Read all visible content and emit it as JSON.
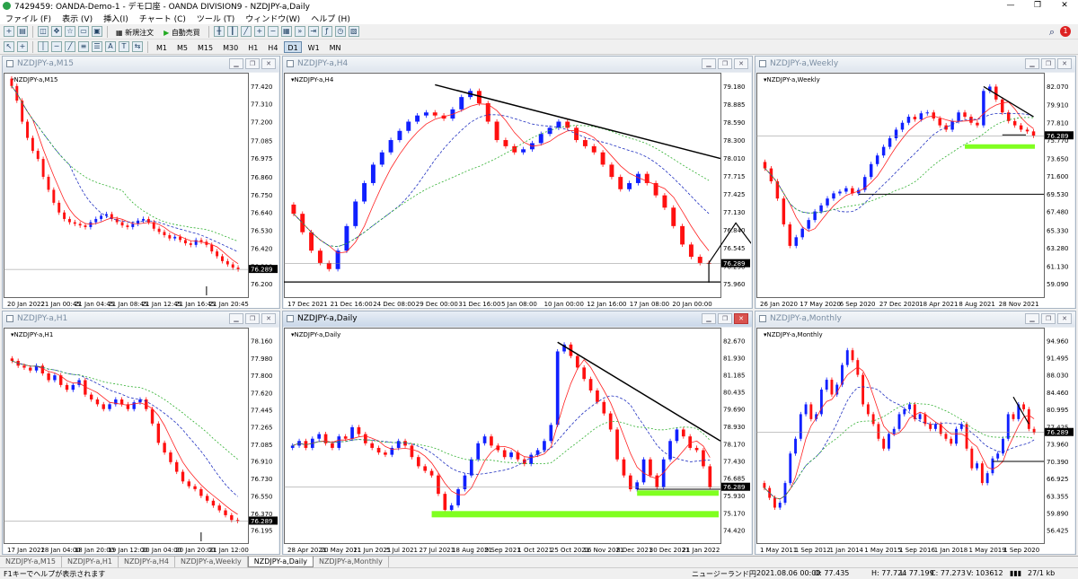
{
  "window": {
    "title": "7429459: OANDA-Demo-1 - デモ口座 - OANDA DIVISION9 - NZDJPY-a,Daily",
    "min": "—",
    "max": "❐",
    "close": "✕"
  },
  "menu": [
    "ファイル (F)",
    "表示 (V)",
    "挿入(I)",
    "チャート (C)",
    "ツール (T)",
    "ウィンドウ(W)",
    "ヘルプ (H)"
  ],
  "toolbar": {
    "new_order": "新規注文",
    "auto_trade": "自動売買"
  },
  "timeframes": [
    "M1",
    "M5",
    "M15",
    "M30",
    "H1",
    "H4",
    "D1",
    "W1",
    "MN"
  ],
  "selected_timeframe": "D1",
  "charts": {
    "m15": {
      "title": "NZDJPY-a,M15",
      "label": "NZDJPY-a,M15",
      "price": "76.289",
      "yticks": [
        "77.420",
        "77.310",
        "77.200",
        "77.085",
        "76.975",
        "76.860",
        "76.750",
        "76.640",
        "76.530",
        "76.420",
        "76.310",
        "76.200"
      ],
      "xticks": [
        "20 Jan 2022",
        "21 Jan 00:45",
        "21 Jan 04:45",
        "21 Jan 08:45",
        "21 Jan 12:45",
        "21 Jan 16:45",
        "21 Jan 20:45"
      ],
      "close": [
        77.42,
        77.33,
        77.2,
        77.1,
        77.02,
        76.97,
        76.86,
        76.78,
        76.7,
        76.64,
        76.6,
        76.58,
        76.57,
        76.56,
        76.55,
        76.58,
        76.6,
        76.62,
        76.63,
        76.6,
        76.58,
        76.56,
        76.55,
        76.57,
        76.59,
        76.6,
        76.58,
        76.54,
        76.52,
        76.5,
        76.48,
        76.49,
        76.47,
        76.45,
        76.44,
        76.47,
        76.46,
        76.44,
        76.4,
        76.37,
        76.34,
        76.32,
        76.3,
        76.29
      ]
    },
    "h4": {
      "title": "NZDJPY-a,H4",
      "label": "NZDJPY-a,H4",
      "price": "76.289",
      "yticks": [
        "79.180",
        "78.885",
        "78.590",
        "78.300",
        "78.010",
        "77.715",
        "77.425",
        "77.130",
        "76.840",
        "76.545",
        "76.250",
        "75.960"
      ],
      "xticks": [
        "17 Dec 2021",
        "21 Dec 16:00",
        "24 Dec 08:00",
        "29 Dec 00:00",
        "31 Dec 16:00",
        "5 Jan 08:00",
        "10 Jan 00:00",
        "12 Jan 16:00",
        "17 Jan 08:00",
        "20 Jan 00:00"
      ],
      "close": [
        77.1,
        76.8,
        76.5,
        76.3,
        76.2,
        76.5,
        76.9,
        77.3,
        77.6,
        77.9,
        78.1,
        78.3,
        78.45,
        78.6,
        78.7,
        78.75,
        78.7,
        78.65,
        78.8,
        79.0,
        79.1,
        78.9,
        78.6,
        78.3,
        78.2,
        78.1,
        78.15,
        78.25,
        78.4,
        78.5,
        78.6,
        78.5,
        78.3,
        78.2,
        78.1,
        77.9,
        77.7,
        77.5,
        77.6,
        77.75,
        77.6,
        77.4,
        77.2,
        76.9,
        76.6,
        76.4,
        76.3,
        76.29
      ]
    },
    "weekly": {
      "title": "NZDJPY-a,Weekly",
      "label": "NZDJPY-a,Weekly",
      "price": "76.289",
      "yticks": [
        "82.070",
        "79.910",
        "77.810",
        "75.770",
        "73.650",
        "71.600",
        "69.530",
        "67.480",
        "65.330",
        "63.280",
        "61.130",
        "59.090"
      ],
      "xticks": [
        "26 Jan 2020",
        "17 May 2020",
        "6 Sep 2020",
        "27 Dec 2020",
        "18 Apr 2021",
        "8 Aug 2021",
        "28 Nov 2021"
      ],
      "close": [
        72.5,
        71.0,
        69.0,
        66.0,
        63.5,
        64.5,
        65.5,
        66.5,
        67.5,
        68.2,
        69.0,
        69.6,
        69.8,
        70.2,
        69.6,
        70.0,
        71.5,
        73.0,
        74.0,
        75.0,
        76.0,
        77.0,
        77.8,
        78.5,
        78.2,
        78.9,
        79.0,
        78.3,
        77.5,
        77.0,
        78.0,
        79.0,
        78.5,
        77.8,
        77.5,
        81.5,
        82.0,
        80.5,
        79.0,
        78.0,
        77.5,
        77.0,
        76.8,
        76.3
      ]
    },
    "h1": {
      "title": "NZDJPY-a,H1",
      "label": "NZDJPY-a,H1",
      "price": "76.289",
      "yticks": [
        "78.160",
        "77.980",
        "77.800",
        "77.620",
        "77.445",
        "77.265",
        "77.085",
        "76.910",
        "76.730",
        "76.550",
        "76.370",
        "76.195"
      ],
      "xticks": [
        "17 Jan 2022",
        "18 Jan 04:00",
        "18 Jan 20:00",
        "19 Jan 12:00",
        "20 Jan 04:00",
        "20 Jan 20:00",
        "21 Jan 12:00"
      ],
      "close": [
        77.95,
        77.9,
        77.88,
        77.85,
        77.9,
        77.82,
        77.75,
        77.8,
        77.7,
        77.65,
        77.7,
        77.75,
        77.6,
        77.55,
        77.5,
        77.45,
        77.5,
        77.55,
        77.5,
        77.45,
        77.52,
        77.55,
        77.45,
        77.3,
        77.1,
        77.0,
        76.9,
        76.8,
        76.7,
        76.65,
        76.62,
        76.55,
        76.5,
        76.45,
        76.4,
        76.35,
        76.3,
        76.29
      ]
    },
    "daily": {
      "title": "NZDJPY-a,Daily",
      "label": "NZDJPY-a,Daily",
      "price": "76.289",
      "yticks": [
        "82.670",
        "81.930",
        "81.185",
        "80.435",
        "79.690",
        "78.930",
        "78.170",
        "77.430",
        "76.685",
        "75.930",
        "75.170",
        "74.420"
      ],
      "xticks": [
        "28 Apr 2021",
        "20 May 2021",
        "11 Jun 2021",
        "5 Jul 2021",
        "27 Jul 2021",
        "18 Aug 2021",
        "9 Sep 2021",
        "1 Oct 2021",
        "25 Oct 2021",
        "16 Nov 2021",
        "8 Dec 2021",
        "30 Dec 2021",
        "21 Jan 2022"
      ],
      "close": [
        78.1,
        78.3,
        78.0,
        78.4,
        78.6,
        78.2,
        78.0,
        78.5,
        78.4,
        78.9,
        78.6,
        78.2,
        78.0,
        77.8,
        77.7,
        78.0,
        78.3,
        78.1,
        77.6,
        77.2,
        77.0,
        76.8,
        76.0,
        75.3,
        75.5,
        76.2,
        76.8,
        77.5,
        78.2,
        78.5,
        78.1,
        77.9,
        77.6,
        77.8,
        77.5,
        77.3,
        77.7,
        77.9,
        78.3,
        79.0,
        82.2,
        82.5,
        82.0,
        81.5,
        81.0,
        80.5,
        80.0,
        79.5,
        78.8,
        77.5,
        76.8,
        76.2,
        76.5,
        77.5,
        76.8,
        76.3,
        77.5,
        78.3,
        78.8,
        78.5,
        78.0,
        77.9,
        77.2,
        76.29
      ]
    },
    "monthly": {
      "title": "NZDJPY-a,Monthly",
      "label": "NZDJPY-a,Monthly",
      "price": "76.289",
      "yticks": [
        "94.960",
        "91.495",
        "88.030",
        "84.460",
        "80.995",
        "77.425",
        "73.960",
        "70.390",
        "66.925",
        "63.355",
        "59.890",
        "56.425"
      ],
      "xticks": [
        "1 May 2011",
        "1 Sep 2012",
        "1 Jan 2014",
        "1 May 2015",
        "1 Sep 2016",
        "1 Jan 2018",
        "1 May 2019",
        "1 Sep 2020"
      ],
      "close": [
        65,
        63,
        61,
        62,
        66,
        72,
        75,
        80,
        82,
        79,
        80,
        85,
        87,
        84,
        86,
        90,
        93,
        91,
        88,
        82,
        80,
        78,
        75,
        73,
        76,
        77,
        80,
        81,
        82,
        79,
        80,
        78,
        77,
        78,
        76,
        75,
        74,
        77,
        78,
        73,
        69,
        70,
        66,
        68,
        71,
        72,
        75,
        80,
        79,
        82,
        81,
        77,
        76.3
      ]
    }
  },
  "tabs": [
    "NZDJPY-a,M15",
    "NZDJPY-a,H1",
    "NZDJPY-a,H4",
    "NZDJPY-a,Weekly",
    "NZDJPY-a,Daily",
    "NZDJPY-a,Monthly"
  ],
  "selected_tab": "NZDJPY-a,Daily",
  "status": {
    "help": "F1キーでヘルプが表示されます",
    "symbol": "ニュージーランド円",
    "datetime": "2021.08.06 00:00",
    "open": "O: 77.435",
    "high": "H: 77.724",
    "low": "L: 77.199",
    "close": "C: 77.273",
    "volume": "V: 103612",
    "traffic": "27/1 kb"
  },
  "colors": {
    "bull": "#1020ff",
    "bear": "#ff1010",
    "ma_fast": "#ff2020",
    "ma_mid": "#2030c0",
    "ma_slow": "#30b030",
    "zone": "#80ff20"
  }
}
